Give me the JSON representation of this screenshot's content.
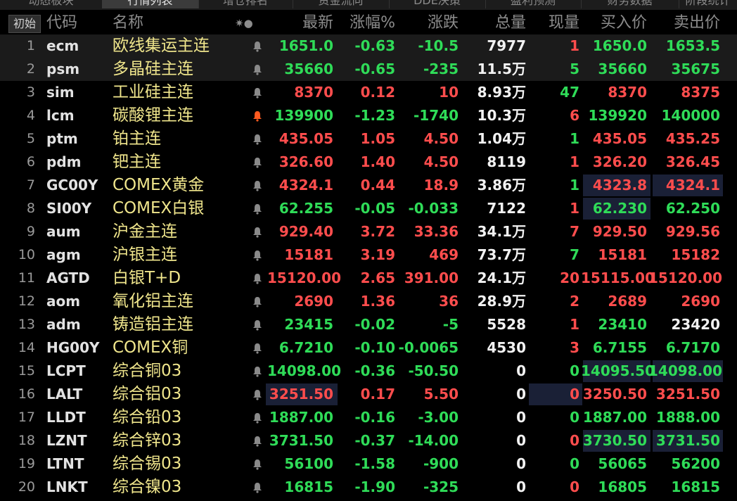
{
  "tabs": [
    "动态板块",
    "行情列表",
    "增仓排名",
    "资金流向",
    "DDE决策",
    "盈利预测",
    "财务数据",
    "阶段统计"
  ],
  "active_tab": 1,
  "init_button": "初始",
  "headers": {
    "code": "代码",
    "name": "名称",
    "icons": "✷●",
    "last": "最新",
    "pct": "涨幅%",
    "chg": "涨跌",
    "vol": "总量",
    "cur": "现量",
    "bid": "买入价",
    "ask": "卖出价"
  },
  "colors": {
    "up": "#ff4d4d",
    "down": "#2fdc58",
    "name": "#f0e68c",
    "neutral": "#f2f2f2"
  },
  "rows": [
    {
      "idx": "1",
      "code": "ecm",
      "name": "欧线集运主连",
      "alert": false,
      "last": "1651.0",
      "pct": "-0.63",
      "chg": "-10.5",
      "vol": "7977",
      "cur": "1",
      "bid": "1650.0",
      "ask": "1653.5",
      "dir": "down",
      "cur_dir": "up",
      "bid_dir": "down",
      "ask_dir": "down"
    },
    {
      "idx": "2",
      "code": "psm",
      "name": "多晶硅主连",
      "alert": false,
      "last": "35660",
      "pct": "-0.65",
      "chg": "-235",
      "vol": "11.5万",
      "cur": "5",
      "bid": "35660",
      "ask": "35675",
      "dir": "down",
      "cur_dir": "down",
      "bid_dir": "down",
      "ask_dir": "down"
    },
    {
      "idx": "3",
      "code": "sim",
      "name": "工业硅主连",
      "alert": false,
      "last": "8370",
      "pct": "0.12",
      "chg": "10",
      "vol": "8.93万",
      "cur": "47",
      "bid": "8370",
      "ask": "8375",
      "dir": "up",
      "cur_dir": "down",
      "bid_dir": "up",
      "ask_dir": "up"
    },
    {
      "idx": "4",
      "code": "lcm",
      "name": "碳酸锂主连",
      "alert": true,
      "last": "139900",
      "pct": "-1.23",
      "chg": "-1740",
      "vol": "10.3万",
      "cur": "6",
      "bid": "139920",
      "ask": "140000",
      "dir": "down",
      "cur_dir": "up",
      "bid_dir": "down",
      "ask_dir": "down"
    },
    {
      "idx": "5",
      "code": "ptm",
      "name": "铂主连",
      "alert": false,
      "last": "435.05",
      "pct": "1.05",
      "chg": "4.50",
      "vol": "1.04万",
      "cur": "1",
      "bid": "435.05",
      "ask": "435.25",
      "dir": "up",
      "cur_dir": "down",
      "bid_dir": "up",
      "ask_dir": "up"
    },
    {
      "idx": "6",
      "code": "pdm",
      "name": "钯主连",
      "alert": false,
      "last": "326.60",
      "pct": "1.40",
      "chg": "4.50",
      "vol": "8119",
      "cur": "1",
      "bid": "326.20",
      "ask": "326.45",
      "dir": "up",
      "cur_dir": "up",
      "bid_dir": "up",
      "ask_dir": "up"
    },
    {
      "idx": "7",
      "code": "GC00Y",
      "name": "COMEX黄金",
      "alert": false,
      "last": "4324.1",
      "pct": "0.44",
      "chg": "18.9",
      "vol": "3.86万",
      "cur": "1",
      "bid": "4323.8",
      "ask": "4324.1",
      "dir": "up",
      "cur_dir": "down",
      "bid_dir": "up",
      "ask_dir": "up",
      "box_bid": true,
      "box_ask": true
    },
    {
      "idx": "8",
      "code": "SI00Y",
      "name": "COMEX白银",
      "alert": false,
      "last": "62.255",
      "pct": "-0.05",
      "chg": "-0.033",
      "vol": "7122",
      "cur": "1",
      "bid": "62.230",
      "ask": "62.250",
      "dir": "down",
      "cur_dir": "up",
      "bid_dir": "down",
      "ask_dir": "down",
      "box_bid": true
    },
    {
      "idx": "9",
      "code": "aum",
      "name": "沪金主连",
      "alert": false,
      "last": "929.40",
      "pct": "3.72",
      "chg": "33.36",
      "vol": "34.1万",
      "cur": "7",
      "bid": "929.50",
      "ask": "929.56",
      "dir": "up",
      "cur_dir": "up",
      "bid_dir": "up",
      "ask_dir": "up"
    },
    {
      "idx": "10",
      "code": "agm",
      "name": "沪银主连",
      "alert": false,
      "last": "15181",
      "pct": "3.19",
      "chg": "469",
      "vol": "73.7万",
      "cur": "7",
      "bid": "15181",
      "ask": "15182",
      "dir": "up",
      "cur_dir": "down",
      "bid_dir": "up",
      "ask_dir": "up"
    },
    {
      "idx": "11",
      "code": "AGTD",
      "name": "白银T+D",
      "alert": false,
      "last": "15120.00",
      "pct": "2.65",
      "chg": "391.00",
      "vol": "24.1万",
      "cur": "20",
      "bid": "15115.00",
      "ask": "15120.00",
      "dir": "up",
      "cur_dir": "up",
      "bid_dir": "up",
      "ask_dir": "up"
    },
    {
      "idx": "12",
      "code": "aom",
      "name": "氧化铝主连",
      "alert": false,
      "last": "2690",
      "pct": "1.36",
      "chg": "36",
      "vol": "28.9万",
      "cur": "2",
      "bid": "2689",
      "ask": "2690",
      "dir": "up",
      "cur_dir": "up",
      "bid_dir": "up",
      "ask_dir": "up"
    },
    {
      "idx": "13",
      "code": "adm",
      "name": "铸造铝主连",
      "alert": false,
      "last": "23415",
      "pct": "-0.02",
      "chg": "-5",
      "vol": "5528",
      "cur": "1",
      "bid": "23410",
      "ask": "23420",
      "dir": "down",
      "cur_dir": "up",
      "bid_dir": "down",
      "ask_dir": "neutral"
    },
    {
      "idx": "14",
      "code": "HG00Y",
      "name": "COMEX铜",
      "alert": false,
      "last": "6.7210",
      "pct": "-0.10",
      "chg": "-0.0065",
      "vol": "4530",
      "cur": "3",
      "bid": "6.7155",
      "ask": "6.7170",
      "dir": "down",
      "cur_dir": "up",
      "bid_dir": "down",
      "ask_dir": "down"
    },
    {
      "idx": "15",
      "code": "LCPT",
      "name": "综合铜03",
      "alert": false,
      "last": "14098.00",
      "pct": "-0.36",
      "chg": "-50.50",
      "vol": "0",
      "cur": "0",
      "bid": "14095.50",
      "ask": "14098.00",
      "dir": "down",
      "cur_dir": "down",
      "bid_dir": "down",
      "ask_dir": "down",
      "box_bid": true,
      "box_ask": true
    },
    {
      "idx": "16",
      "code": "LALT",
      "name": "综合铝03",
      "alert": false,
      "last": "3251.50",
      "pct": "0.17",
      "chg": "5.50",
      "vol": "0",
      "cur": "0",
      "bid": "3250.50",
      "ask": "3251.50",
      "dir": "up",
      "cur_dir": "up",
      "bid_dir": "up",
      "ask_dir": "up",
      "box_last": true,
      "box_cur": true
    },
    {
      "idx": "17",
      "code": "LLDT",
      "name": "综合铅03",
      "alert": false,
      "last": "1887.00",
      "pct": "-0.16",
      "chg": "-3.00",
      "vol": "0",
      "cur": "0",
      "bid": "1887.00",
      "ask": "1888.00",
      "dir": "down",
      "cur_dir": "down",
      "bid_dir": "down",
      "ask_dir": "down"
    },
    {
      "idx": "18",
      "code": "LZNT",
      "name": "综合锌03",
      "alert": false,
      "last": "3731.50",
      "pct": "-0.37",
      "chg": "-14.00",
      "vol": "0",
      "cur": "0",
      "bid": "3730.50",
      "ask": "3731.50",
      "dir": "down",
      "cur_dir": "up",
      "bid_dir": "down",
      "ask_dir": "down",
      "box_bid": true,
      "box_ask": true
    },
    {
      "idx": "19",
      "code": "LTNT",
      "name": "综合锡03",
      "alert": false,
      "last": "56100",
      "pct": "-1.58",
      "chg": "-900",
      "vol": "0",
      "cur": "0",
      "bid": "56065",
      "ask": "56200",
      "dir": "down",
      "cur_dir": "down",
      "bid_dir": "down",
      "ask_dir": "down"
    },
    {
      "idx": "20",
      "code": "LNKT",
      "name": "综合镍03",
      "alert": false,
      "last": "16815",
      "pct": "-1.90",
      "chg": "-325",
      "vol": "0",
      "cur": "0",
      "bid": "16805",
      "ask": "16815",
      "dir": "down",
      "cur_dir": "up",
      "bid_dir": "down",
      "ask_dir": "down"
    }
  ]
}
